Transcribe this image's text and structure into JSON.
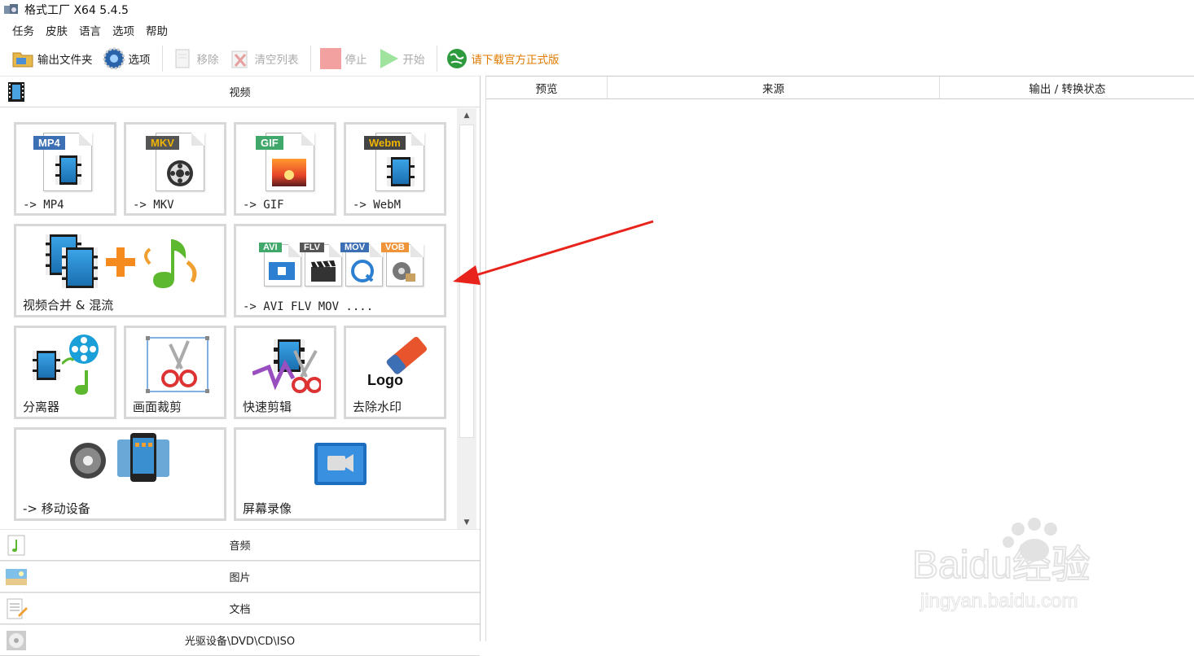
{
  "window": {
    "title": "格式工厂 X64 5.4.5"
  },
  "menu": [
    "任务",
    "皮肤",
    "语言",
    "选项",
    "帮助"
  ],
  "toolbar": {
    "output_folder": "输出文件夹",
    "options": "选项",
    "remove": "移除",
    "clear_list": "清空列表",
    "stop": "停止",
    "start": "开始",
    "download": "请下载官方正式版"
  },
  "categories": {
    "video": "视频",
    "audio": "音频",
    "image": "图片",
    "document": "文档",
    "disc": "光驱设备\\DVD\\CD\\ISO"
  },
  "tiles": [
    {
      "label": "-> MP4",
      "tag": "MP4"
    },
    {
      "label": "-> MKV",
      "tag": "MKV"
    },
    {
      "label": "-> GIF",
      "tag": "GIF"
    },
    {
      "label": "-> WebM",
      "tag": "Webm"
    },
    {
      "label": "视频合并 & 混流"
    },
    {
      "label": "-> AVI FLV MOV ....",
      "tags": [
        "AVI",
        "FLV",
        "MOV",
        "VOB"
      ]
    },
    {
      "label": "分离器"
    },
    {
      "label": "画面裁剪"
    },
    {
      "label": "快速剪辑"
    },
    {
      "label": "去除水印",
      "logo_text": "Logo"
    },
    {
      "label": "-> 移动设备"
    },
    {
      "label": "屏幕录像"
    }
  ],
  "table_headers": [
    "预览",
    "来源",
    "输出 / 转换状态"
  ],
  "watermark": {
    "brand": "Baidu经验",
    "url": "jingyan.baidu.com"
  },
  "colors": {
    "mp4": "#3d6fb5",
    "mkv": "#555555",
    "gif": "#3fa86a",
    "webm": "#444444",
    "promo": "#e07a00",
    "arrow": "#e8231b"
  }
}
